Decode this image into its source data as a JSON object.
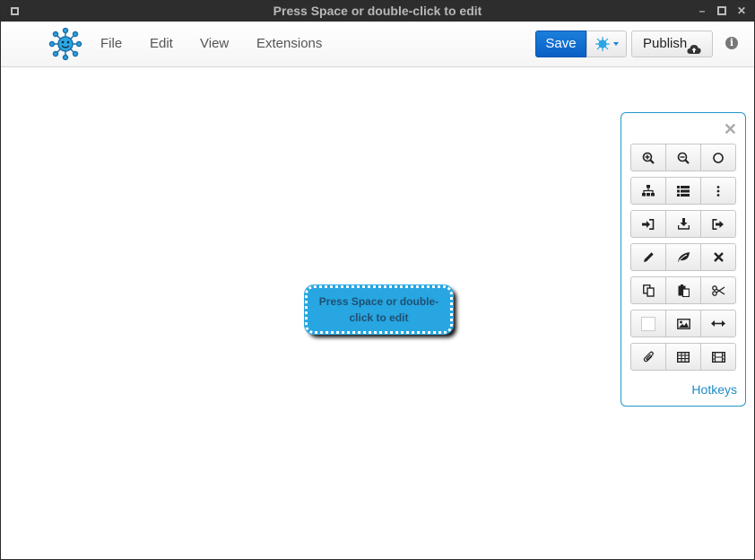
{
  "window": {
    "title": "Press Space or double-click to edit"
  },
  "menu": {
    "file": "File",
    "edit": "Edit",
    "view": "View",
    "extensions": "Extensions"
  },
  "toolbar": {
    "save_label": "Save",
    "publish_label": "Publish",
    "theme_icon": "theme-dropdown-icon",
    "info_icon": "info-icon"
  },
  "canvas": {
    "node_text": "Press Space or double-click to edit"
  },
  "tool_panel": {
    "rows": [
      [
        "zoom-in-icon",
        "zoom-out-icon",
        "circle-icon"
      ],
      [
        "hierarchy-icon",
        "list-icon",
        "more-vertical-icon"
      ],
      [
        "sign-in-icon",
        "download-icon",
        "sign-out-icon"
      ],
      [
        "pencil-icon",
        "leaf-icon",
        "delete-icon"
      ],
      [
        "copy-icon",
        "paste-icon",
        "cut-icon"
      ],
      [
        "color-swatch-icon",
        "image-icon",
        "horizontal-arrows-icon"
      ],
      [
        "paperclip-icon",
        "table-icon",
        "film-icon"
      ]
    ],
    "hotkeys_label": "Hotkeys"
  },
  "colors": {
    "accent": "#1b7fdb",
    "node_fill": "#27a6e1",
    "panel_border": "#2196c9",
    "titlebar": "#2d2d2d"
  }
}
